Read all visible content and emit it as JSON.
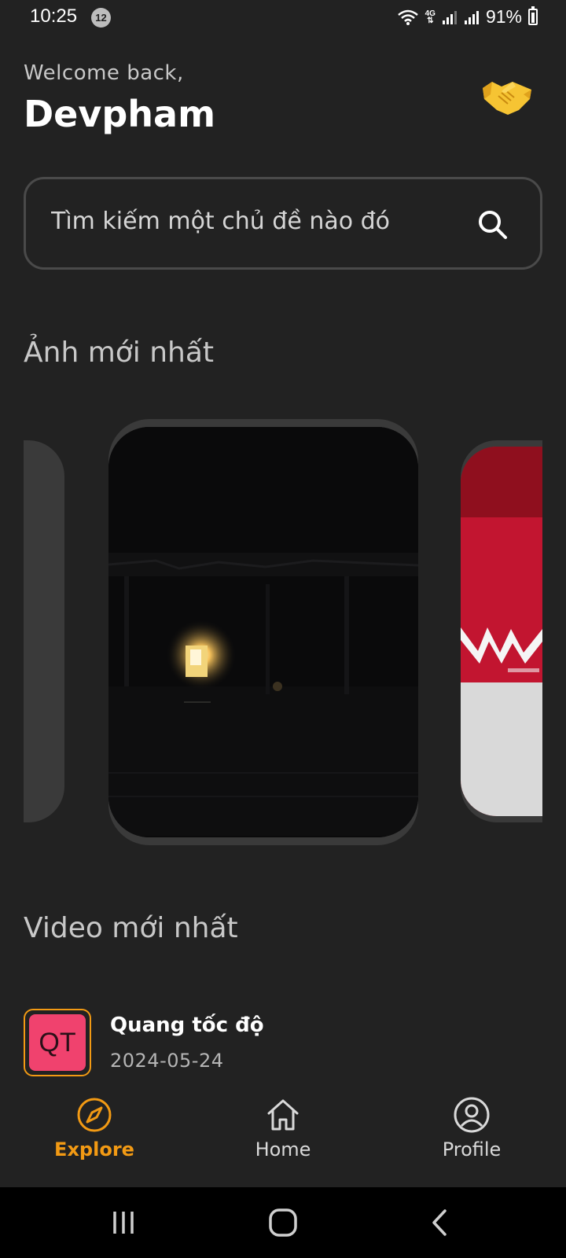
{
  "status_bar": {
    "time": "10:25",
    "notification_count": "12",
    "network_label": "4G",
    "battery_percent": "91%"
  },
  "header": {
    "welcome_text": "Welcome back,",
    "username": "Devpham",
    "greeting_icon": "handshake-icon"
  },
  "search": {
    "placeholder": "Tìm kiếm một chủ đề nào đó",
    "icon": "search-icon"
  },
  "photos_section": {
    "title": "Ảnh mới nhất"
  },
  "videos_section": {
    "title": "Video mới nhất",
    "items": [
      {
        "thumb_text": "QT",
        "title": "Quang tốc độ",
        "date": "2024-05-24"
      }
    ]
  },
  "bottom_nav": {
    "items": [
      {
        "label": "Explore",
        "icon": "compass-icon",
        "active": true
      },
      {
        "label": "Home",
        "icon": "home-icon",
        "active": false
      },
      {
        "label": "Profile",
        "icon": "user-circle-icon",
        "active": false
      }
    ]
  },
  "colors": {
    "background": "#222222",
    "accent": "#f29a14",
    "thumb_pink": "#f0426e"
  }
}
